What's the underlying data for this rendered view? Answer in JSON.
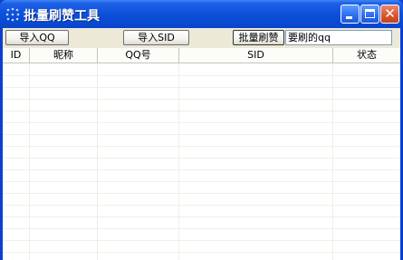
{
  "window": {
    "title": "批量刷赞工具"
  },
  "toolbar": {
    "import_qq_label": "导入QQ",
    "import_sid_label": "导入SID",
    "batch_like_label": "批量刷赞",
    "qq_input_value": "要刷的qq"
  },
  "table": {
    "columns": [
      "ID",
      "昵称",
      "QQ号",
      "SID",
      "状态"
    ],
    "rows": []
  },
  "colors": {
    "titlebar": "#0b4fd8",
    "client_bg": "#ece9d8",
    "close_button": "#d9542a"
  }
}
